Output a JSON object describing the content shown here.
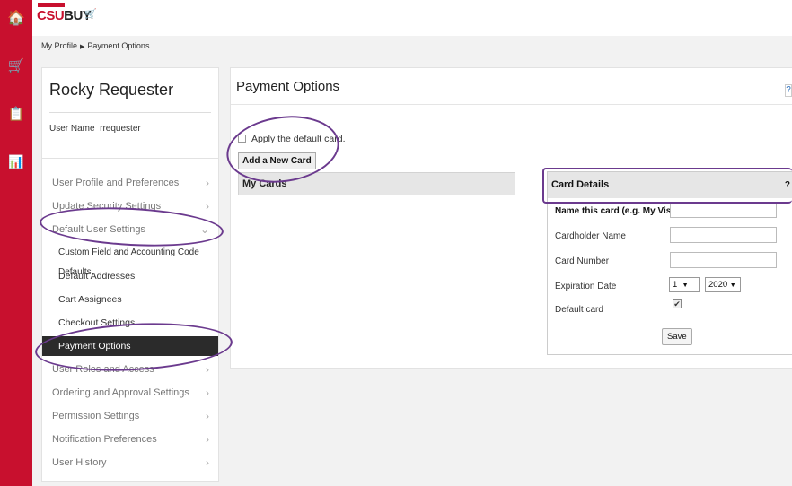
{
  "header": {
    "logo_csu": "CSU",
    "logo_buy": "BUY",
    "logo_cart": "🛒"
  },
  "rail": {
    "items": [
      {
        "icon": "home-icon",
        "glyph": "🏠"
      },
      {
        "icon": "cart-icon",
        "glyph": "🛒"
      },
      {
        "icon": "orders-icon",
        "glyph": "📋"
      },
      {
        "icon": "reports-icon",
        "glyph": "📊"
      }
    ]
  },
  "breadcrumb": {
    "root": "My Profile",
    "separator": "▶",
    "current": "Payment Options"
  },
  "profile": {
    "name": "Rocky Requester",
    "username_label": "User Name",
    "username": "rrequester"
  },
  "nav": {
    "items": [
      {
        "label": "User Profile and Preferences",
        "sub": false,
        "active": false,
        "chevron": "›"
      },
      {
        "label": "Update Security Settings",
        "sub": false,
        "active": false,
        "chevron": "›"
      },
      {
        "label": "Default User Settings",
        "sub": false,
        "active": false,
        "chevron": "⌄"
      },
      {
        "label": "Custom Field and Accounting Code Defaults",
        "sub": true,
        "active": false,
        "chevron": ""
      },
      {
        "label": "Default Addresses",
        "sub": true,
        "active": false,
        "chevron": ""
      },
      {
        "label": "Cart Assignees",
        "sub": true,
        "active": false,
        "chevron": ""
      },
      {
        "label": "Checkout Settings",
        "sub": true,
        "active": false,
        "chevron": ""
      },
      {
        "label": "Payment Options",
        "sub": true,
        "active": true,
        "chevron": ""
      },
      {
        "label": "User Roles and Access",
        "sub": false,
        "active": false,
        "chevron": "›"
      },
      {
        "label": "Ordering and Approval Settings",
        "sub": false,
        "active": false,
        "chevron": "›"
      },
      {
        "label": "Permission Settings",
        "sub": false,
        "active": false,
        "chevron": "›"
      },
      {
        "label": "Notification Preferences",
        "sub": false,
        "active": false,
        "chevron": "›"
      },
      {
        "label": "User History",
        "sub": false,
        "active": false,
        "chevron": "›"
      }
    ]
  },
  "main": {
    "title": "Payment Options",
    "help": "?",
    "apply_default_label": "Apply the default card.",
    "add_card_button": "Add a New Card",
    "my_cards_header": "My Cards"
  },
  "card_details": {
    "header": "Card Details",
    "help": "?",
    "name_label": "Name this card (e.g. My Visa)",
    "cardholder_label": "Cardholder Name",
    "number_label": "Card Number",
    "expiration_label": "Expiration Date",
    "exp_month": "1",
    "exp_year": "2020",
    "select_arrow": "▼",
    "default_label": "Default card",
    "default_checked": "✔",
    "save_button": "Save"
  },
  "colors": {
    "brand_red": "#c8102e",
    "annotation_purple": "#6b3a8e",
    "active_nav": "#2b2b2b"
  }
}
